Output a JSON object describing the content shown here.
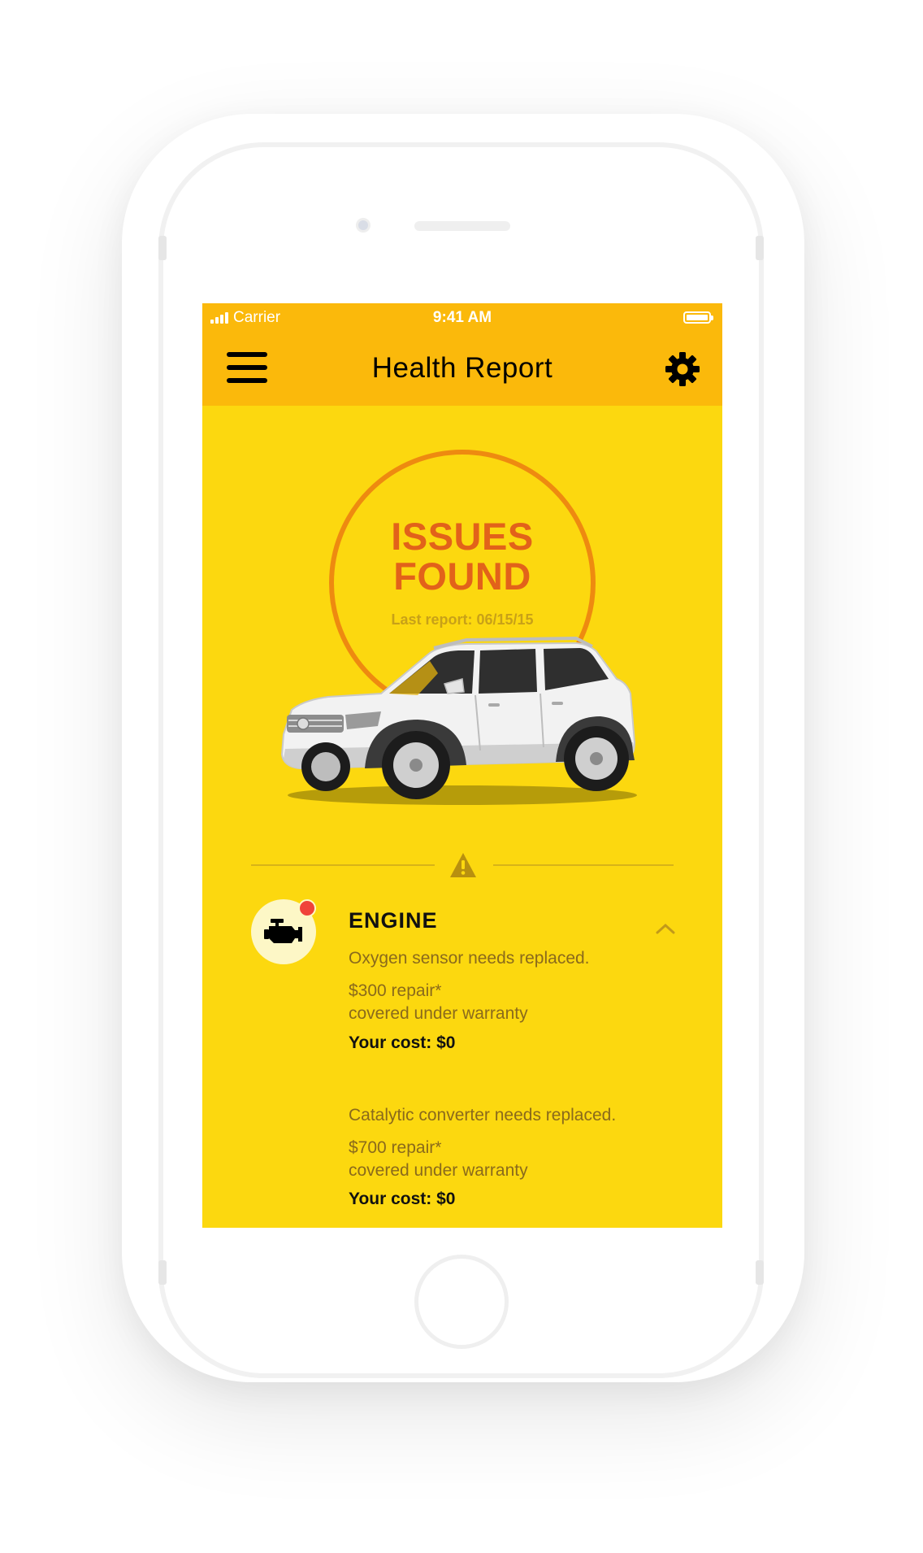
{
  "status_bar": {
    "carrier": "Carrier",
    "time": "9:41 AM"
  },
  "header": {
    "title": "Health Report",
    "menu_icon": "hamburger-menu-icon",
    "settings_icon": "gear-icon"
  },
  "report": {
    "status_line1": "ISSUES",
    "status_line2": "FOUND",
    "last_report": "Last report: 06/15/15"
  },
  "section": {
    "title": "ENGINE",
    "icon": "engine-icon",
    "issues": [
      {
        "description": "Oxygen sensor needs replaced.",
        "repair": "$300 repair*",
        "coverage": "covered under warranty",
        "cost": "Your cost: $0"
      },
      {
        "description": "Catalytic converter needs replaced.",
        "repair": "$700 repair*",
        "coverage": "covered under warranty",
        "cost": "Your cost: $0"
      }
    ]
  },
  "colors": {
    "screen_background": "#fcd80f",
    "header_background": "#fbb90b",
    "status_accent": "#e2621a",
    "alert": "#f0423a"
  }
}
